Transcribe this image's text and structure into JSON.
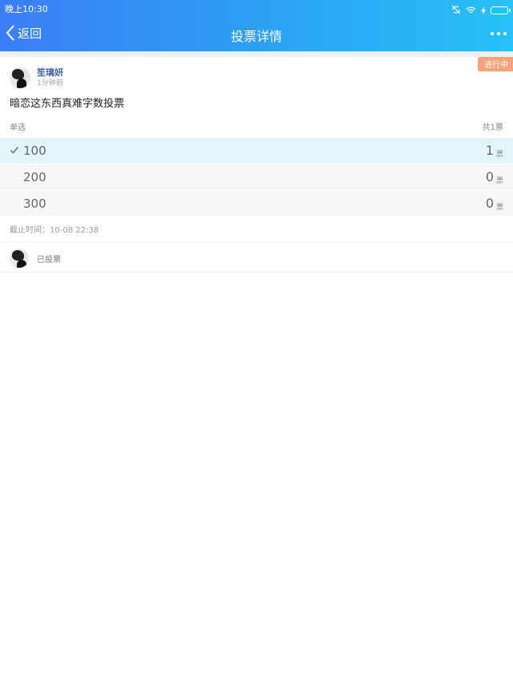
{
  "status_bar": {
    "time": "晚上10:30"
  },
  "nav": {
    "back_label": "返回",
    "title": "投票详情"
  },
  "poll": {
    "status_badge": "进行中",
    "author": {
      "name": "笙璃妍",
      "time": "1分钟前"
    },
    "title": "暗恋这东西真难字数投票",
    "type_label": "单选",
    "total_label": "共1票",
    "options": [
      {
        "label": "100",
        "count": "1",
        "unit": "票",
        "selected": true
      },
      {
        "label": "200",
        "count": "0",
        "unit": "票",
        "selected": false
      },
      {
        "label": "300",
        "count": "0",
        "unit": "票",
        "selected": false
      }
    ],
    "deadline": "截止时间：10-08 22:38",
    "voted_label": "已投票"
  },
  "colors": {
    "header_start": "#3b7df5",
    "header_end": "#27c1f7",
    "badge": "#f5a37a",
    "selected_bg": "#e4f4fb"
  },
  "icons": [
    "back-chevron-icon",
    "more-icon",
    "check-icon",
    "wifi-icon",
    "battery-icon",
    "sync-icon"
  ]
}
